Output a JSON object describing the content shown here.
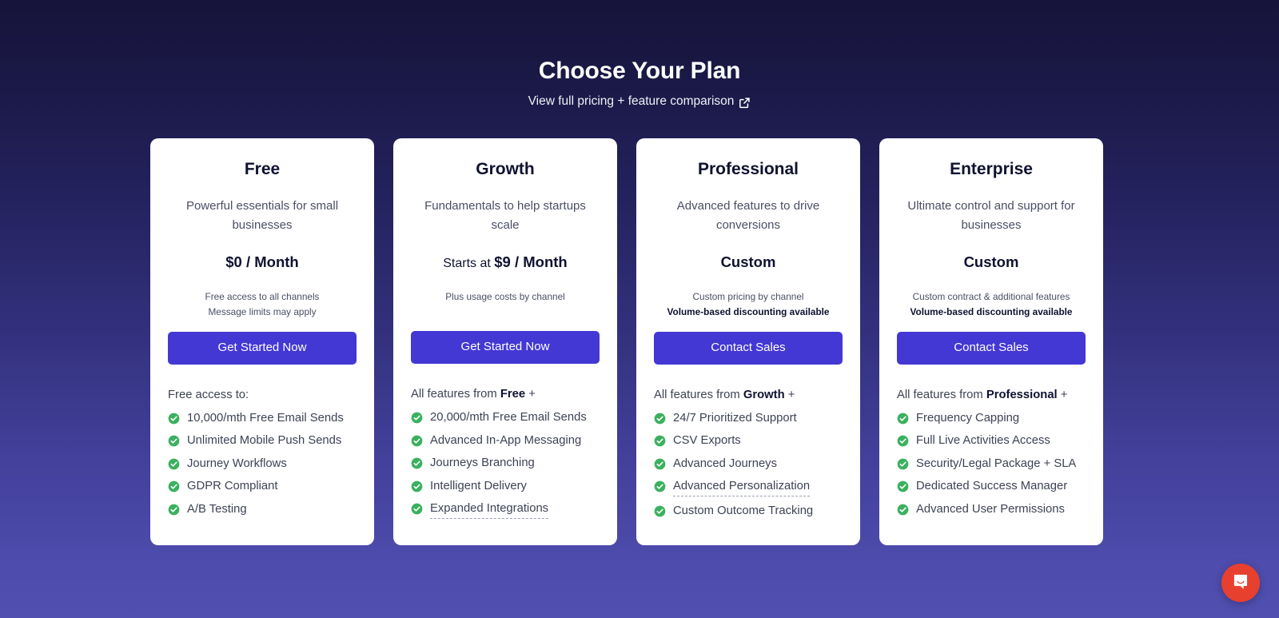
{
  "header": {
    "title": "Choose Your Plan",
    "subtitle_link": "View full pricing + feature comparison",
    "subtitle_icon": "external-link-icon"
  },
  "theme": {
    "background_top": "#16143a",
    "background_bottom": "#5150b0",
    "cta_color": "#4338d4",
    "check_color": "#3ab15e",
    "chat_color": "#e8402f",
    "card_background": "#ffffff"
  },
  "plans": [
    {
      "name": "Free",
      "description": "Powerful essentials for small businesses",
      "price_prefix": "",
      "price": "$0 / Month",
      "note_line1": "Free access to all channels",
      "note_line2": "Message limits may apply",
      "note_line2_bold": false,
      "cta": "Get Started Now",
      "features_heading_prefix": "Free access to:",
      "features_heading_bold": "",
      "features_heading_suffix": "",
      "features": [
        {
          "label": "10,000/mth Free Email Sends",
          "tooltip": false
        },
        {
          "label": "Unlimited Mobile Push Sends",
          "tooltip": false
        },
        {
          "label": "Journey Workflows",
          "tooltip": false
        },
        {
          "label": "GDPR Compliant",
          "tooltip": false
        },
        {
          "label": "A/B Testing",
          "tooltip": false
        }
      ]
    },
    {
      "name": "Growth",
      "description": "Fundamentals to help startups scale",
      "price_prefix": "Starts at ",
      "price": "$9 / Month",
      "note_line1": "Plus usage costs by channel",
      "note_line2": "",
      "note_line2_bold": false,
      "cta": "Get Started Now",
      "features_heading_prefix": "All features from ",
      "features_heading_bold": "Free",
      "features_heading_suffix": " +",
      "features": [
        {
          "label": "20,000/mth Free Email Sends",
          "tooltip": false
        },
        {
          "label": "Advanced In-App Messaging",
          "tooltip": false
        },
        {
          "label": "Journeys Branching",
          "tooltip": false
        },
        {
          "label": "Intelligent Delivery",
          "tooltip": false
        },
        {
          "label": "Expanded Integrations",
          "tooltip": true
        }
      ]
    },
    {
      "name": "Professional",
      "description": "Advanced features to drive conversions",
      "price_prefix": "",
      "price": "Custom",
      "note_line1": "Custom pricing by channel",
      "note_line2": "Volume-based discounting available",
      "note_line2_bold": true,
      "cta": "Contact Sales",
      "features_heading_prefix": "All features from ",
      "features_heading_bold": "Growth",
      "features_heading_suffix": " +",
      "features": [
        {
          "label": "24/7 Prioritized Support",
          "tooltip": false
        },
        {
          "label": "CSV Exports",
          "tooltip": false
        },
        {
          "label": "Advanced Journeys",
          "tooltip": false
        },
        {
          "label": "Advanced Personalization",
          "tooltip": true
        },
        {
          "label": "Custom Outcome Tracking",
          "tooltip": false
        }
      ]
    },
    {
      "name": "Enterprise",
      "description": "Ultimate control and support for businesses",
      "price_prefix": "",
      "price": "Custom",
      "note_line1": "Custom contract & additional features",
      "note_line2": "Volume-based discounting available",
      "note_line2_bold": true,
      "cta": "Contact Sales",
      "features_heading_prefix": "All features from ",
      "features_heading_bold": "Professional",
      "features_heading_suffix": " +",
      "features": [
        {
          "label": "Frequency Capping",
          "tooltip": false
        },
        {
          "label": "Full Live Activities Access",
          "tooltip": false
        },
        {
          "label": "Security/Legal Package + SLA",
          "tooltip": false
        },
        {
          "label": "Dedicated Success Manager",
          "tooltip": false
        },
        {
          "label": "Advanced User Permissions",
          "tooltip": false
        }
      ]
    }
  ],
  "chat_widget": {
    "icon": "chat-bubble-icon",
    "label": "Open chat"
  }
}
